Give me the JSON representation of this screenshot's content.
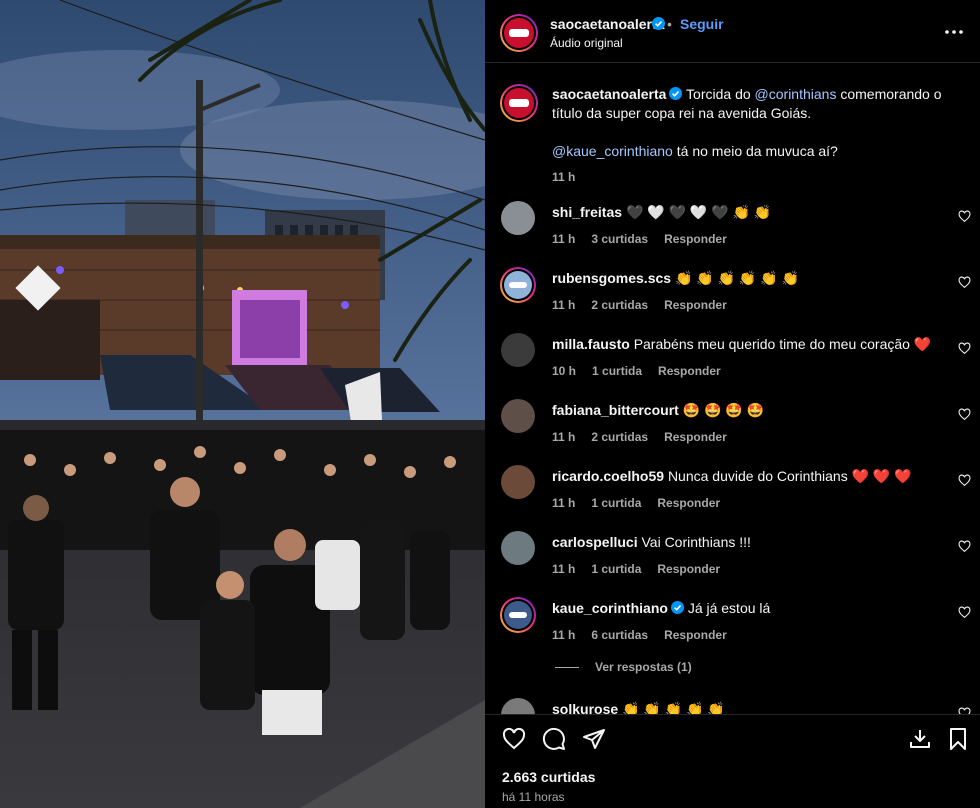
{
  "post": {
    "username": "saocaetanoalerta",
    "follow_label": "Seguir",
    "separator": "•",
    "audio": "Áudio original",
    "likes": "2.663 curtidas",
    "time_ago": "há 11 horas"
  },
  "caption": {
    "username": "saocaetanoalerta",
    "pre": "Torcida do ",
    "mention": "@corinthians",
    "post": " comemorando o título da super copa rei na avenida Goiás.",
    "mention2": "@kaue_corinthiano",
    "post2": " tá no meio da muvuca aí?",
    "time": "11 h"
  },
  "comments": [
    {
      "user": "shi_freitas",
      "text": "🖤 🤍 🖤 🤍 🖤 👏 👏",
      "time": "11 h",
      "likes": "3 curtidas",
      "reply": "Responder"
    },
    {
      "user": "rubensgomes.scs",
      "text": "👏 👏 👏 👏 👏 👏",
      "time": "11 h",
      "likes": "2 curtidas",
      "reply": "Responder"
    },
    {
      "user": "milla.fausto",
      "text": "Parabéns meu querido time do meu coração ❤️",
      "time": "10 h",
      "likes": "1 curtida",
      "reply": "Responder"
    },
    {
      "user": "fabiana_bittercourt",
      "text": "🤩 🤩 🤩 🤩",
      "time": "11 h",
      "likes": "2 curtidas",
      "reply": "Responder"
    },
    {
      "user": "ricardo.coelho59",
      "text": "Nunca duvide do Corinthians ❤️ ❤️ ❤️",
      "time": "11 h",
      "likes": "1 curtida",
      "reply": "Responder"
    },
    {
      "user": "carlospelluci",
      "text": "Vai Corinthians !!!",
      "time": "11 h",
      "likes": "1 curtida",
      "reply": "Responder"
    },
    {
      "user": "kaue_corinthiano",
      "text": "Já já estou lá",
      "time": "11 h",
      "likes": "6 curtidas",
      "reply": "Responder"
    },
    {
      "user": "solkurose",
      "text": "👏 👏 👏 👏 👏",
      "time": "",
      "likes": "",
      "reply": ""
    }
  ],
  "view_replies": "Ver respostas (1)",
  "colors": {
    "accent": "#5b9dff",
    "mention": "#a6c8ff",
    "background": "#000000",
    "muted": "#a8a8a8"
  },
  "icons": [
    "more-icon",
    "heart-icon",
    "comment-icon",
    "share-icon",
    "bookmark-icon",
    "verified-icon",
    "download-icon"
  ]
}
